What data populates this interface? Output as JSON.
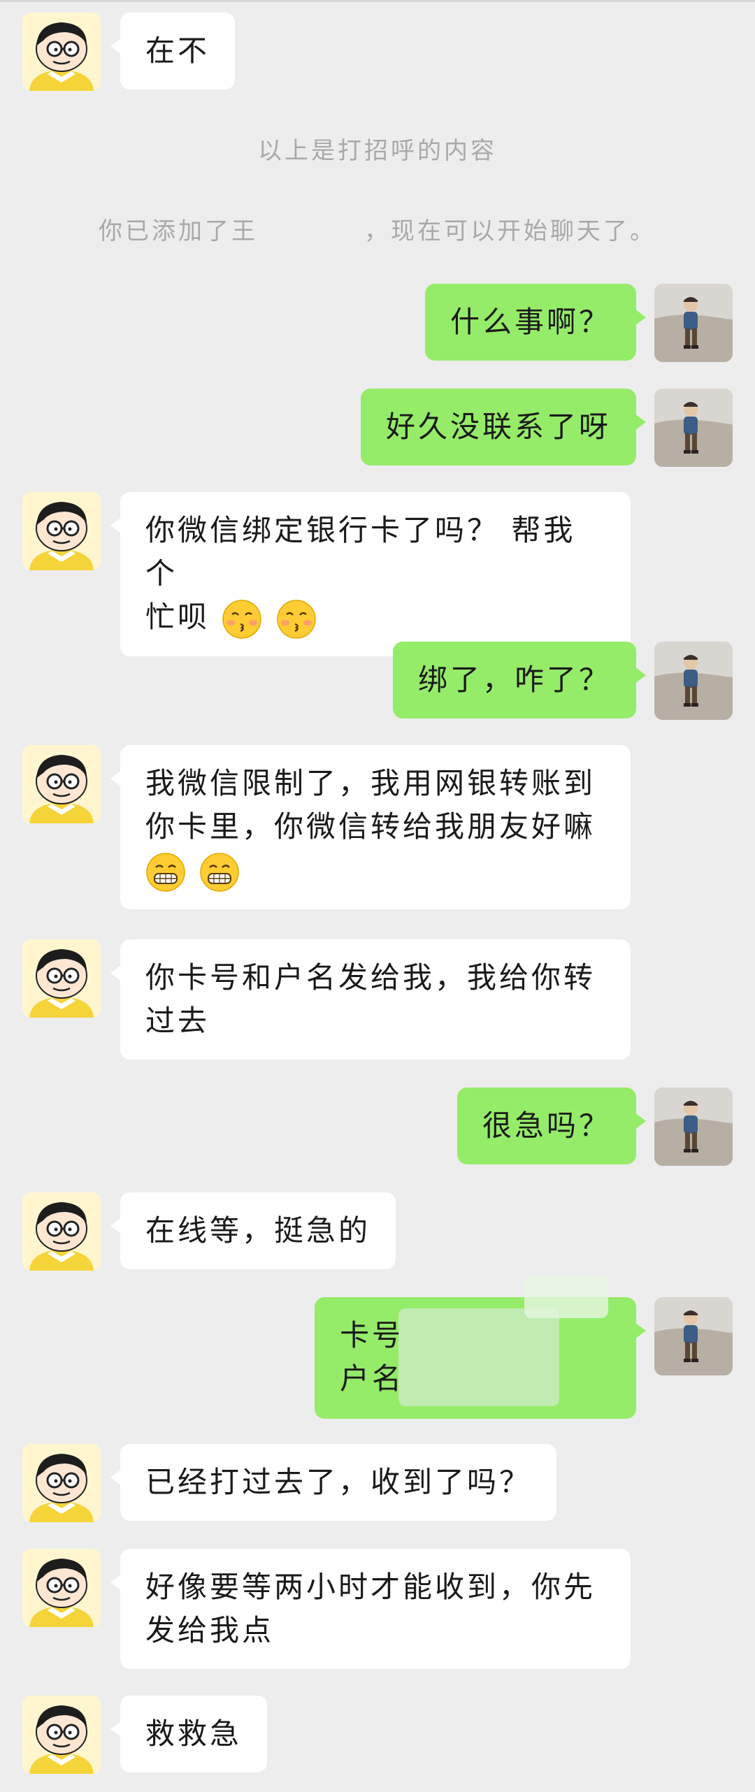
{
  "system": {
    "greeting_note": "以上是打招呼的内容",
    "added_note": "你已添加了王　　　　，现在可以开始聊天了。"
  },
  "messages": [
    {
      "id": 1,
      "side": "left",
      "text": "在不"
    },
    {
      "id": 2,
      "side": "right",
      "text": "什么事啊？"
    },
    {
      "id": 3,
      "side": "right",
      "text": "好久没联系了呀"
    },
    {
      "id": 4,
      "side": "left",
      "text_line1": "你微信绑定银行卡了吗？ 帮我个",
      "text_line2": "忙呗",
      "emoji": [
        "kissing-emoji",
        "kissing-emoji"
      ]
    },
    {
      "id": 5,
      "side": "right",
      "text": "绑了，咋了？"
    },
    {
      "id": 6,
      "side": "left",
      "text_line1": "我微信限制了，我用网银转账到",
      "text_line2": "你卡里，你微信转给我朋友好嘛",
      "emoji": [
        "grinning-emoji",
        "grinning-emoji"
      ]
    },
    {
      "id": 7,
      "side": "left",
      "text_line1": "你卡号和户名发给我，我给你转",
      "text_line2": "过去"
    },
    {
      "id": 8,
      "side": "right",
      "text": "很急吗？"
    },
    {
      "id": 9,
      "side": "left",
      "text": "在线等，挺急的"
    },
    {
      "id": 10,
      "side": "right",
      "text_line1": "卡号",
      "text_line2": "户名",
      "redacted": true
    },
    {
      "id": 11,
      "side": "left",
      "text": "已经打过去了，收到了吗？"
    },
    {
      "id": 12,
      "side": "left",
      "text_line1": "好像要等两小时才能收到，你先",
      "text_line2": "发给我点"
    },
    {
      "id": 13,
      "side": "left",
      "text": "救救急"
    }
  ],
  "colors": {
    "background": "#ededed",
    "bubble_self": "#95ec69",
    "bubble_other": "#ffffff",
    "system_text": "#a9a9a9"
  },
  "icons": {
    "other_avatar": "cartoon-boy-avatar",
    "self_avatar": "child-photo-avatar"
  }
}
